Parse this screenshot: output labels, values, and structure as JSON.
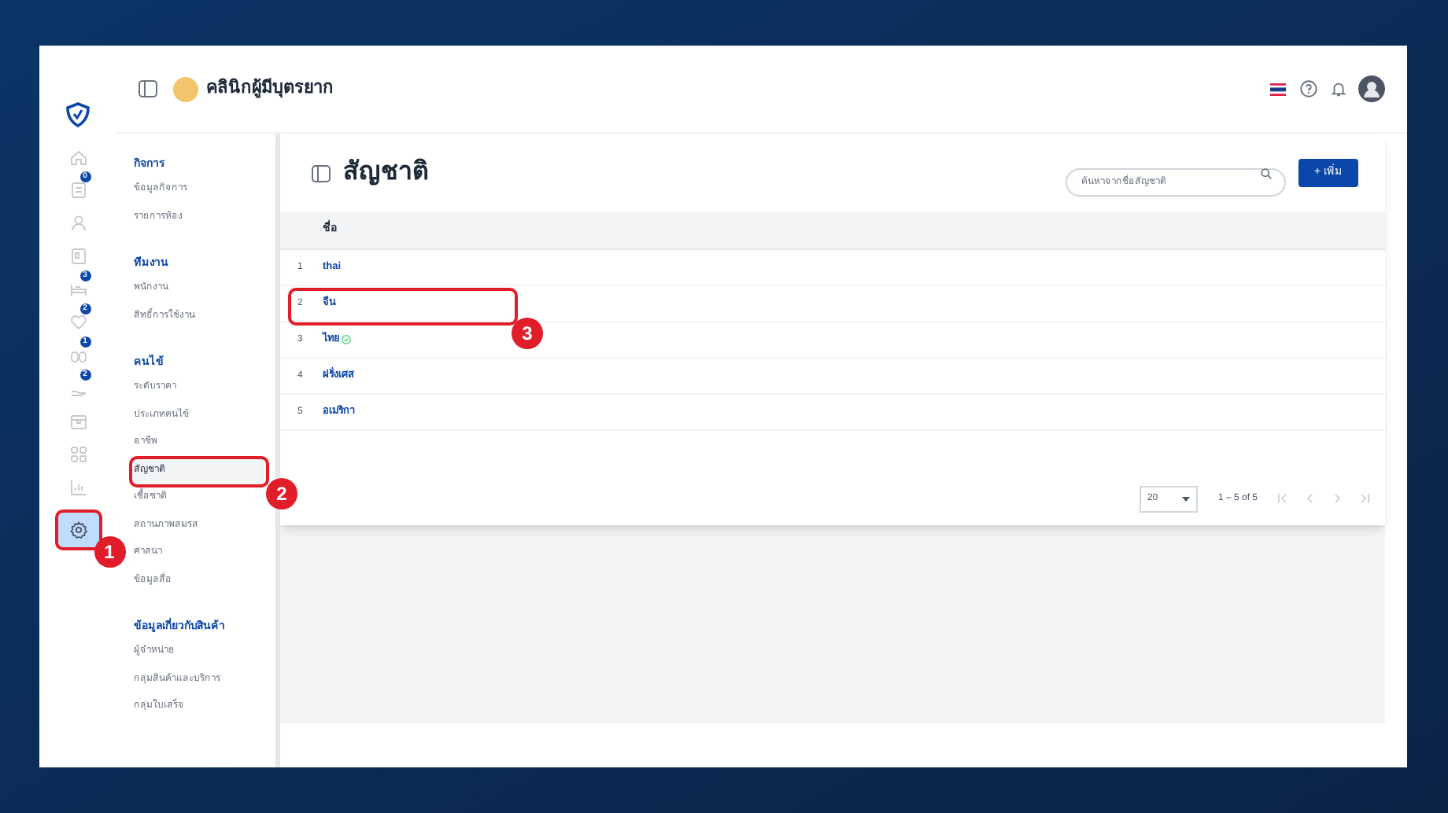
{
  "header": {
    "clinic_name": "คลินิกผู้มีบุตรยาก"
  },
  "rail": [
    {
      "selected": false
    },
    {
      "badge": "0",
      "selected": false
    },
    {
      "selected": false
    },
    {
      "selected": false
    },
    {
      "badge": "3",
      "selected": false
    },
    {
      "badge": "2",
      "selected": false
    },
    {
      "badge": "1",
      "selected": false
    },
    {
      "badge": "2",
      "selected": false
    },
    {
      "selected": false
    },
    {
      "selected": false
    },
    {
      "selected": false
    },
    {
      "selected": true,
      "annotation": "1"
    }
  ],
  "sidebar": {
    "sections": [
      {
        "title": "กิจการ",
        "items": [
          {
            "label": "ข้อมูลกิจการ",
            "selected": false
          },
          {
            "label": "รายการห้อง",
            "selected": false
          }
        ]
      },
      {
        "title": "ทีมงาน",
        "items": [
          {
            "label": "พนักงาน",
            "selected": false
          },
          {
            "label": "สิทธิ์การใช้งาน",
            "selected": false
          }
        ]
      },
      {
        "title": "คนไข้",
        "items": [
          {
            "label": "ระดับราคา",
            "selected": false
          },
          {
            "label": "ประเภทคนไข้",
            "selected": false
          },
          {
            "label": "อาชีพ",
            "selected": false
          },
          {
            "label": "สัญชาติ",
            "selected": true,
            "annotation": "2"
          },
          {
            "label": "เชื้อชาติ",
            "selected": false
          },
          {
            "label": "สถานภาพสมรส",
            "selected": false
          },
          {
            "label": "ศาสนา",
            "selected": false
          },
          {
            "label": "ข้อมูลสื่อ",
            "selected": false
          }
        ]
      },
      {
        "title": "ข้อมูลเกี่ยวกับสินค้า",
        "items": [
          {
            "label": "ผู้จำหน่าย",
            "selected": false
          },
          {
            "label": "กลุ่มสินค้าและบริการ",
            "selected": false
          },
          {
            "label": "กลุ่มใบเสร็จ",
            "selected": false
          }
        ]
      }
    ]
  },
  "page": {
    "title": "สัญชาติ",
    "search": {
      "placeholder": "ค้นหาจากชื่อสัญชาติ"
    },
    "add_button": "+ เพิ่ม"
  },
  "table": {
    "columns": [
      "ชื่อ"
    ],
    "rows": [
      {
        "index": "1",
        "name": "thai",
        "default": false
      },
      {
        "index": "2",
        "name": "จีน",
        "default": false,
        "annotation": "3"
      },
      {
        "index": "3",
        "name": "ไทย",
        "default": true
      },
      {
        "index": "4",
        "name": "ฝรั่งเศส",
        "default": false
      },
      {
        "index": "5",
        "name": "อเมริกา",
        "default": false
      }
    ]
  },
  "pagination": {
    "page_size": "20",
    "range": "1 – 5 of 5"
  }
}
